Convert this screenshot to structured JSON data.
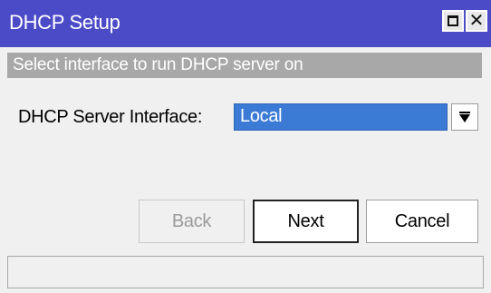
{
  "window": {
    "title": "DHCP Setup",
    "subheader": "Select interface to run DHCP server on",
    "titlebar_color": "#4b4bc8",
    "accent_select_color": "#3b7bd6",
    "icons": {
      "maximize": "maximize-icon",
      "close": "close-icon",
      "dropdown": "dropdown-arrow-icon"
    }
  },
  "form": {
    "interface_label": "DHCP Server Interface:",
    "interface_value": "Local"
  },
  "buttons": {
    "back": "Back",
    "next": "Next",
    "cancel": "Cancel"
  },
  "status": {
    "text": ""
  }
}
